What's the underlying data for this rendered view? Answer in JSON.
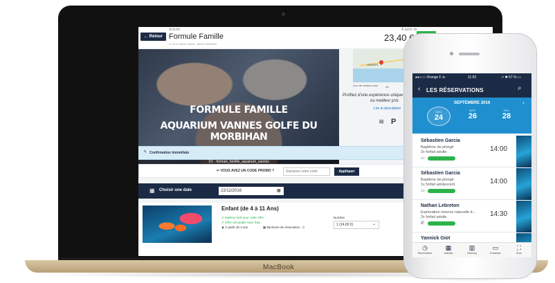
{
  "laptop": {
    "brand": "MacBook",
    "header": {
      "back_label": "← Retour",
      "breadcrumb": "Activité",
      "title": "Formule Famille",
      "address": "21 Rue Daniel Gilard - 56000 VANNES",
      "price_label": "À partir de",
      "price": "23,40 €",
      "choose_label": "Choisir"
    },
    "hero": {
      "line1": "FORMULE FAMILLE",
      "line2": "AQUARIUM VANNES GOLFE DU MORBIHAN",
      "caption": "1/1 - formule_famille_aquarium_vannes"
    },
    "map": {
      "town": "VANNES",
      "caption": "Lieu de rendez-vous"
    },
    "quote": {
      "mark": "“",
      "line1": "Profitez d'une expérience unique",
      "line2": "ou meilleur prix.",
      "link": "Lire la description"
    },
    "amenities": {
      "wifi_icon": "wifi-icon",
      "parking_icon": "parking-icon",
      "parking_glyph": "P",
      "wifi_glyph": "≋"
    },
    "confirm": {
      "icon": "ϟ",
      "label": "Confirmation immédiate"
    },
    "promo": {
      "label": "✂ VOUS AVEZ UN CODE PROMO ?",
      "placeholder": "Saisissez votre code",
      "apply_label": "Appliquer"
    },
    "date": {
      "icon": "▦",
      "label": "Choisir une date",
      "value": "22/12/2016",
      "picker_icon": "▦"
    },
    "offer": {
      "title": "Enfant (de 4 à 11 Ans)",
      "features": [
        "✔ Meilleur tarif pour cette offre",
        "✔ Offre annulable sans frais"
      ],
      "detail1": "♟ À partir de 4 ans",
      "detail2": "▦ Minimum de réservation : 3",
      "number_label": "Nombre",
      "number_value": "1  (24,00 €)",
      "chevron": "⌄"
    }
  },
  "phone": {
    "status": {
      "carrier": "●●○○○ Orange F ≋",
      "time": "11:52",
      "battery": "↗ ✱ 57 % ▭"
    },
    "nav": {
      "back": "‹",
      "title": "LES RÉSERVATIONS",
      "search": "⌕"
    },
    "calendar": {
      "month": "SEPTEMBRE 2016",
      "next": "›",
      "days": [
        {
          "name": "SAM.",
          "num": "24"
        },
        {
          "name": "MER.",
          "num": "26"
        },
        {
          "name": "VEN.",
          "num": "28"
        }
      ]
    },
    "reservations": [
      {
        "name": "Sébastien Garcia",
        "activity": "Baptême de plongé",
        "qty": "2x forfait adulte",
        "device": "▭",
        "time": "14:00"
      },
      {
        "name": "Sébastien Garcia",
        "activity": "Baptême de plongé",
        "qty": "1x forfait adolescent",
        "device": "▭",
        "time": "14:00"
      },
      {
        "name": "Nathan Lebreton",
        "activity": "Exploration réserve naturelle d…",
        "qty": "2x forfait adulte",
        "device": "✆",
        "time": "14:30"
      },
      {
        "name": "Yannick Giot",
        "activity": "",
        "qty": "",
        "device": "",
        "time": ""
      }
    ],
    "tabs": [
      {
        "icon": "◷",
        "label": "Réservations"
      },
      {
        "icon": "▦",
        "label": "Activités"
      },
      {
        "icon": "▥",
        "label": "Planning"
      },
      {
        "icon": "▭",
        "label": "Encaisser"
      },
      {
        "icon": "⛶",
        "label": "Scan"
      }
    ]
  }
}
